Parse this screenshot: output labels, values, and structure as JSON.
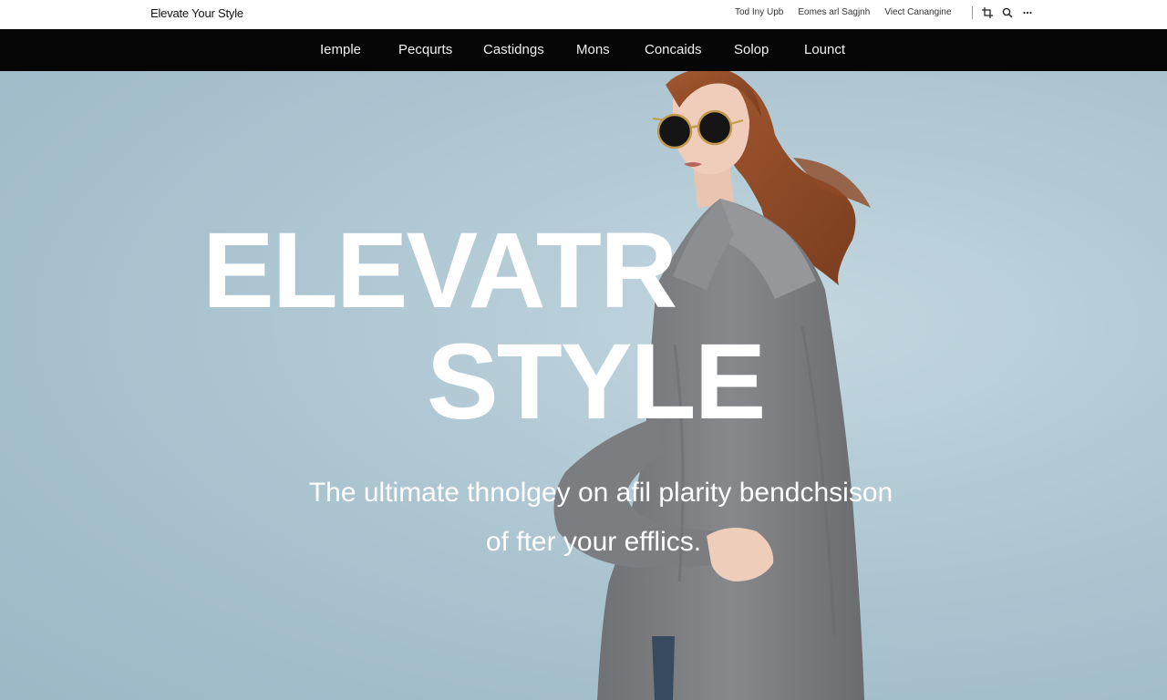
{
  "topbar": {
    "brand": "Elevate Your Style",
    "links": [
      "Tod Iny Upb",
      "Eomes arl Sagjnh",
      "Viect Canangine"
    ],
    "icons": [
      "crop-icon",
      "search-icon",
      "more-icon"
    ]
  },
  "nav": {
    "items": [
      "Iemple",
      "Pecqurts",
      "Castidngs",
      "Mons",
      "Concaids",
      "Solop",
      "Lounct"
    ]
  },
  "hero": {
    "headline_line1": "ELEVATR",
    "headline_line2": "STYLE",
    "tagline_line1": "The ultimate thnolgey on afil plarity bendchsison",
    "tagline_line2": "of fter your efflics."
  },
  "colors": {
    "nav_background": "#050505",
    "hero_background": "#a9c3cf",
    "headline": "#ffffff",
    "coat": "#7d7f82"
  }
}
